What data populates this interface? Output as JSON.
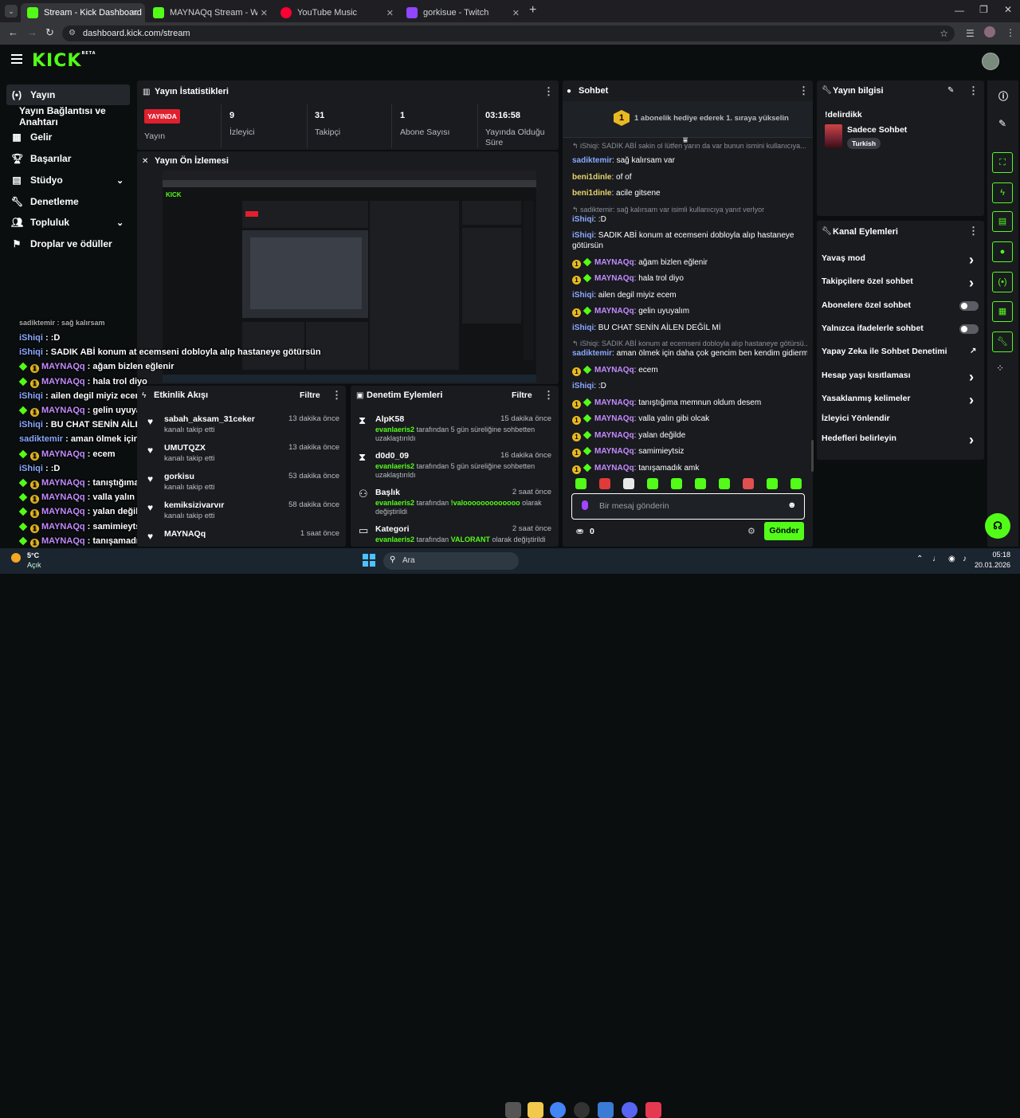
{
  "browser": {
    "tabs": [
      {
        "title": "Stream - Kick Dashboard",
        "icon": "kick-icon",
        "color": "#53fc18"
      },
      {
        "title": "MAYNAQq Stream - Watch Live",
        "icon": "kick-icon",
        "color": "#53fc18"
      },
      {
        "title": "YouTube Music",
        "icon": "youtube-music-icon",
        "color": "#ff0033"
      },
      {
        "title": "gorkisue - Twitch",
        "icon": "twitch-icon",
        "color": "#9146ff"
      }
    ],
    "url": "dashboard.kick.com/stream"
  },
  "brand": {
    "logo": "KICK",
    "beta": "BETA",
    "accent": "#53fc18"
  },
  "sidebar": {
    "items": [
      {
        "label": "Yayın",
        "icon": "broadcast-icon"
      },
      {
        "label": "Yayın Bağlantısı ve Anahtarı",
        "icon": ""
      },
      {
        "label": "Gelir",
        "icon": "revenue-icon"
      },
      {
        "label": "Başarılar",
        "icon": "trophy-icon"
      },
      {
        "label": "Stüdyo",
        "icon": "studio-icon"
      },
      {
        "label": "Denetleme",
        "icon": "wrench-icon"
      },
      {
        "label": "Topluluk",
        "icon": "people-icon"
      },
      {
        "label": "Droplar ve ödüller",
        "icon": "drops-icon"
      }
    ]
  },
  "stats": {
    "title": "Yayın İstatistikleri",
    "live_badge": "YAYINDA",
    "live_label": "Yayın",
    "viewers": "9",
    "viewers_label": "İzleyici",
    "followers": "31",
    "followers_label": "Takipçi",
    "subs": "1",
    "subs_label": "Abone Sayısı",
    "duration": "03:16:58",
    "duration_label": "Yayında Olduğu Süre"
  },
  "preview": {
    "title": "Yayın Ön İzlemesi"
  },
  "overlay_chat": [
    {
      "user": "iShiqi",
      "text": ": :D",
      "color": "#8aa8ff",
      "badges": false
    },
    {
      "user": "iShiqi",
      "text": ": SADIK ABİ konum at ecemseni dobloyla alıp hastaneye götürsün",
      "color": "#8aa8ff",
      "badges": false
    },
    {
      "user": "MAYNAQq",
      "text": ": ağam bizlen eğlenir",
      "color": "#c48bff",
      "badges": true
    },
    {
      "user": "MAYNAQq",
      "text": ": hala trol diyo",
      "color": "#c48bff",
      "badges": true
    },
    {
      "user": "iShiqi",
      "text": ": ailen degil miyiz ecem",
      "color": "#8aa8ff",
      "badges": false
    },
    {
      "user": "MAYNAQq",
      "text": ": gelin uyuyalım",
      "color": "#c48bff",
      "badges": true
    },
    {
      "user": "iShiqi",
      "text": ": BU CHAT SENİN AİLEN DEĞİL Mİ",
      "color": "#8aa8ff",
      "badges": false
    },
    {
      "user": "sadiktemir",
      "text": ": aman ölmek için daha çok gencim ben kendim gidierm",
      "color": "#8aa8ff",
      "badges": false
    },
    {
      "user": "MAYNAQq",
      "text": ": ecem",
      "color": "#c48bff",
      "badges": true
    },
    {
      "user": "iShiqi",
      "text": ": :D",
      "color": "#8aa8ff",
      "badges": false
    },
    {
      "user": "MAYNAQq",
      "text": ": tanıştığıma memnun oldum desem",
      "color": "#c48bff",
      "badges": true
    },
    {
      "user": "MAYNAQq",
      "text": ": valla yalın gibi olcak",
      "color": "#c48bff",
      "badges": true
    },
    {
      "user": "MAYNAQq",
      "text": ": yalan değilde",
      "color": "#c48bff",
      "badges": true
    },
    {
      "user": "MAYNAQq",
      "text": ": samimieytsiz",
      "color": "#c48bff",
      "badges": true
    },
    {
      "user": "MAYNAQq",
      "text": ": tanışamadık amk",
      "color": "#c48bff",
      "badges": true
    }
  ],
  "activity": {
    "title": "Etkinlik Akışı",
    "filter": "Filtre",
    "items": [
      {
        "name": "sabah_aksam_31ceker",
        "sub": "kanalı takip etti",
        "time": "13 dakika önce"
      },
      {
        "name": "UMUTQZX",
        "sub": "kanalı takip etti",
        "time": "13 dakika önce"
      },
      {
        "name": "gorkisu",
        "sub": "kanalı takip etti",
        "time": "53 dakika önce"
      },
      {
        "name": "kemiksizivarvır",
        "sub": "kanalı takip etti",
        "time": "58 dakika önce"
      },
      {
        "name": "MAYNAQq",
        "sub": "",
        "time": "1 saat önce"
      }
    ]
  },
  "moderation": {
    "title": "Denetim Eylemleri",
    "filter": "Filtre",
    "items": [
      {
        "name": "AlpK58",
        "mod": "evanlaeris2",
        "desc": "tarafından 5 gün süreliğine sohbetten",
        "desc2": "uzaklaştırıldı",
        "time": "15 dakika önce",
        "icon": "hourglass-icon"
      },
      {
        "name": "d0d0_09",
        "mod": "evanlaeris2",
        "desc": "tarafından 5 gün süreliğine sohbetten",
        "desc2": "uzaklaştırıldı",
        "time": "16 dakika önce",
        "icon": "hourglass-icon"
      },
      {
        "name": "Başlık",
        "mod": "evanlaeris2",
        "desc": "tarafından",
        "value": "!valooooooooooooo",
        "desc_after": "olarak",
        "desc2": "değiştirildi",
        "time": "2 saat önce",
        "icon": "title-icon"
      },
      {
        "name": "Kategori",
        "mod": "evanlaeris2",
        "desc": "tarafından",
        "value": "VALORANT",
        "desc_after": "olarak değiştirildi",
        "desc2": "",
        "time": "2 saat önce",
        "icon": "category-icon"
      }
    ]
  },
  "chat": {
    "title": "Sohbet",
    "goal_text": "1 abonelik hediye ederek 1. sıraya yükselin",
    "goal_rank": "1",
    "messages": [
      {
        "reply": "iShiqi: SADIK ABİ sakin ol lütfen yarın da var bunun ismini kullanıcıya...",
        "user": "",
        "text": "",
        "color": "#8aa8ff",
        "badges": false
      },
      {
        "reply": "",
        "user": "sadiktemir",
        "text": "sağ kalırsam var",
        "color": "#8aa8ff",
        "badges": false
      },
      {
        "reply": "",
        "user": "beni1dinle",
        "text": "of of",
        "color": "#e8d36b",
        "badges": false
      },
      {
        "reply": "",
        "user": "beni1dinle",
        "text": "acile gitsene",
        "color": "#e8d36b",
        "badges": false
      },
      {
        "reply": "sadiktemir: sağ kalırsam var isimli kullanıcıya yanıt verlyor",
        "user": "iShiqi",
        "text": ":D",
        "color": "#8aa8ff",
        "badges": false
      },
      {
        "reply": "",
        "user": "iShiqi",
        "text": "SADIK ABİ konum at ecemseni dobloyla alıp hastaneye",
        "text2": "götürsün",
        "color": "#8aa8ff",
        "badges": false
      },
      {
        "reply": "",
        "user": "MAYNAQq",
        "text": "ağam bizlen eğlenir",
        "color": "#c48bff",
        "badges": true
      },
      {
        "reply": "",
        "user": "MAYNAQq",
        "text": "hala trol diyo",
        "color": "#c48bff",
        "badges": true
      },
      {
        "reply": "",
        "user": "iShiqi",
        "text": "ailen degil miyiz ecem",
        "color": "#8aa8ff",
        "badges": false
      },
      {
        "reply": "",
        "user": "MAYNAQq",
        "text": "gelin uyuyalım",
        "color": "#c48bff",
        "badges": true
      },
      {
        "reply": "",
        "user": "iShiqi",
        "text": "BU CHAT SENİN AİLEN DEĞİL Mİ",
        "color": "#8aa8ff",
        "badges": false
      },
      {
        "reply": "iShiqi: SADIK ABİ konum at ecemseni dobloyla alıp hastaneye götürsü...",
        "user": "sadiktemir",
        "text": "aman ölmek için daha çok gencim ben kendim gidierm",
        "color": "#8aa8ff",
        "badges": false
      },
      {
        "reply": "",
        "user": "MAYNAQq",
        "text": "ecem",
        "color": "#c48bff",
        "badges": true
      },
      {
        "reply": "",
        "user": "iShiqi",
        "text": ":D",
        "color": "#8aa8ff",
        "badges": false
      },
      {
        "reply": "",
        "user": "MAYNAQq",
        "text": "tanıştığıma memnun oldum desem",
        "color": "#c48bff",
        "badges": true
      },
      {
        "reply": "",
        "user": "MAYNAQq",
        "text": "valla yalın gibi olcak",
        "color": "#c48bff",
        "badges": true
      },
      {
        "reply": "",
        "user": "MAYNAQq",
        "text": "yalan değilde",
        "color": "#c48bff",
        "badges": true
      },
      {
        "reply": "",
        "user": "MAYNAQq",
        "text": "samimieytsiz",
        "color": "#c48bff",
        "badges": true
      },
      {
        "reply": "",
        "user": "MAYNAQq",
        "text": "tanışamadık amk",
        "color": "#c48bff",
        "badges": true
      }
    ],
    "input_placeholder": "Bir mesaj gönderin",
    "points": "0",
    "send_label": "Gönder"
  },
  "info": {
    "title": "Yayın bilgisi",
    "stream_title": "!delirdikk",
    "category": "Sadece Sohbet",
    "language": "Turkish"
  },
  "channel_actions": {
    "title": "Kanal Eylemleri",
    "items": [
      {
        "label": "Yavaş mod",
        "control": "chevron"
      },
      {
        "label": "Takipçilere özel sohbet",
        "control": "chevron"
      },
      {
        "label": "Abonelere özel sohbet",
        "control": "toggle"
      },
      {
        "label": "Yalnızca ifadelerle sohbet",
        "control": "toggle"
      },
      {
        "label": "Yapay Zeka ile Sohbet Denetimi",
        "control": "external"
      },
      {
        "label": "Hesap yaşı kısıtlaması",
        "control": "chevron"
      },
      {
        "label": "Yasaklanmış kelimeler",
        "control": "chevron"
      },
      {
        "label": "İzleyici Yönlendir",
        "control": "none"
      },
      {
        "label": "Hedefleri belirleyin",
        "control": "chevron"
      }
    ]
  },
  "taskbar": {
    "weather_temp": "5°C",
    "weather_desc": "Açık",
    "search": "Ara",
    "time": "05:18",
    "date": "20.01.2026"
  }
}
